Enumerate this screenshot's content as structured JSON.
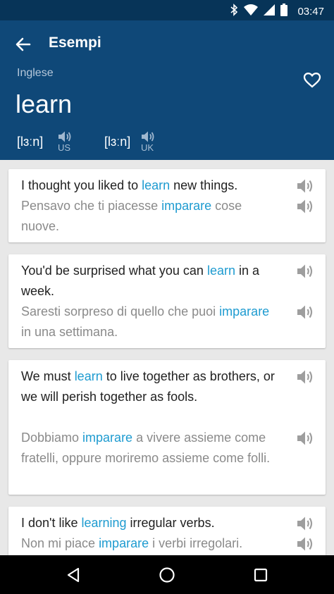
{
  "status_bar": {
    "time": "03:47",
    "icons": [
      "bluetooth-icon",
      "wifi-icon",
      "signal-icon",
      "battery-icon"
    ]
  },
  "header": {
    "title": "Esempi",
    "language": "Inglese",
    "word": "learn",
    "pronunciations": [
      {
        "ipa": "[lɜːn]",
        "region": "US"
      },
      {
        "ipa": "[lɜːn]",
        "region": "UK"
      }
    ]
  },
  "colors": {
    "header": "#0f4878",
    "status_bar": "#073458",
    "highlight": "#1e9bd0"
  },
  "examples": [
    {
      "english": [
        "I thought you liked to ",
        "learn",
        " new things."
      ],
      "italian": [
        "Pensavo che ti piacesse ",
        "imparare",
        " cose nuove."
      ]
    },
    {
      "english": [
        "You'd be surprised what you can ",
        "learn",
        " in a week."
      ],
      "italian": [
        "Saresti sorpreso di quello che puoi ",
        "imparare",
        " in una settimana."
      ]
    },
    {
      "english": [
        "We must ",
        "learn",
        " to live together as brothers, or we will perish together as fools."
      ],
      "italian": [
        "Dobbiamo ",
        "imparare",
        " a vivere assieme come fratelli, oppure moriremo assieme come folli."
      ]
    },
    {
      "english": [
        "I don't like ",
        "learning",
        " irregular verbs."
      ],
      "italian": [
        "Non mi piace ",
        "imparare",
        " i verbi irregolari."
      ]
    }
  ]
}
